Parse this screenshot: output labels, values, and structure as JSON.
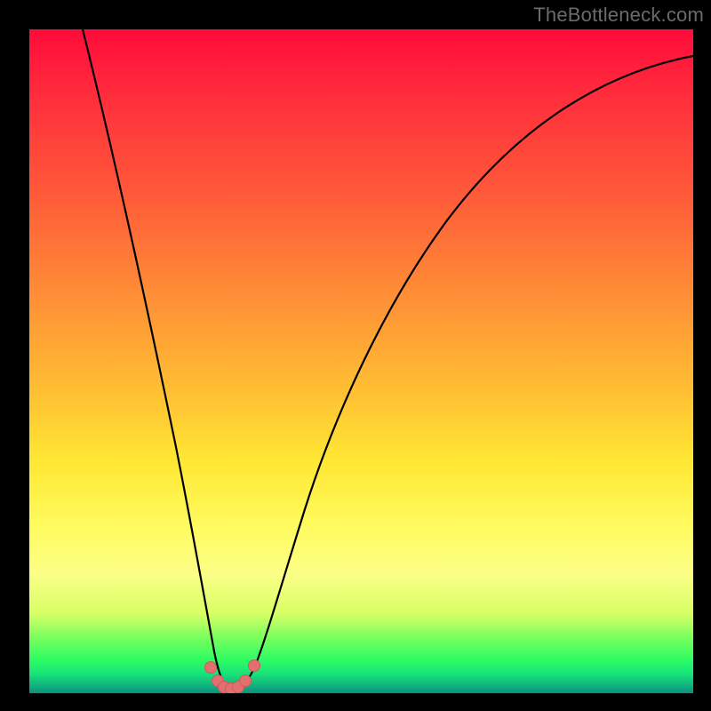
{
  "watermark": "TheBottleneck.com",
  "colors": {
    "frame": "#000000",
    "curve": "#000000",
    "marker_fill": "#e27070",
    "marker_stroke": "#d15a5a"
  },
  "chart_data": {
    "type": "line",
    "title": "",
    "xlabel": "",
    "ylabel": "",
    "xlim": [
      0,
      100
    ],
    "ylim": [
      0,
      100
    ],
    "note": "No axis ticks or labels are visible; all values are estimated from pixel position on a 0–100 normalized scale. Lower y = closer to bottom (green / optimal).",
    "series": [
      {
        "name": "bottleneck-curve",
        "x": [
          8,
          12,
          16,
          20,
          23,
          26,
          28,
          29,
          30,
          31,
          32,
          33,
          35,
          37,
          40,
          45,
          52,
          60,
          70,
          80,
          90,
          100
        ],
        "y": [
          100,
          78,
          58,
          40,
          25,
          12,
          4,
          1,
          0.5,
          0.5,
          1,
          2,
          6,
          12,
          22,
          36,
          52,
          64,
          76,
          84,
          90,
          93
        ]
      }
    ],
    "markers": {
      "name": "highlight-points",
      "x": [
        27.5,
        28.7,
        29.5,
        30.3,
        31.2,
        32.3,
        33.7
      ],
      "y": [
        3.0,
        1.2,
        0.5,
        0.4,
        0.5,
        1.3,
        3.2
      ]
    }
  }
}
